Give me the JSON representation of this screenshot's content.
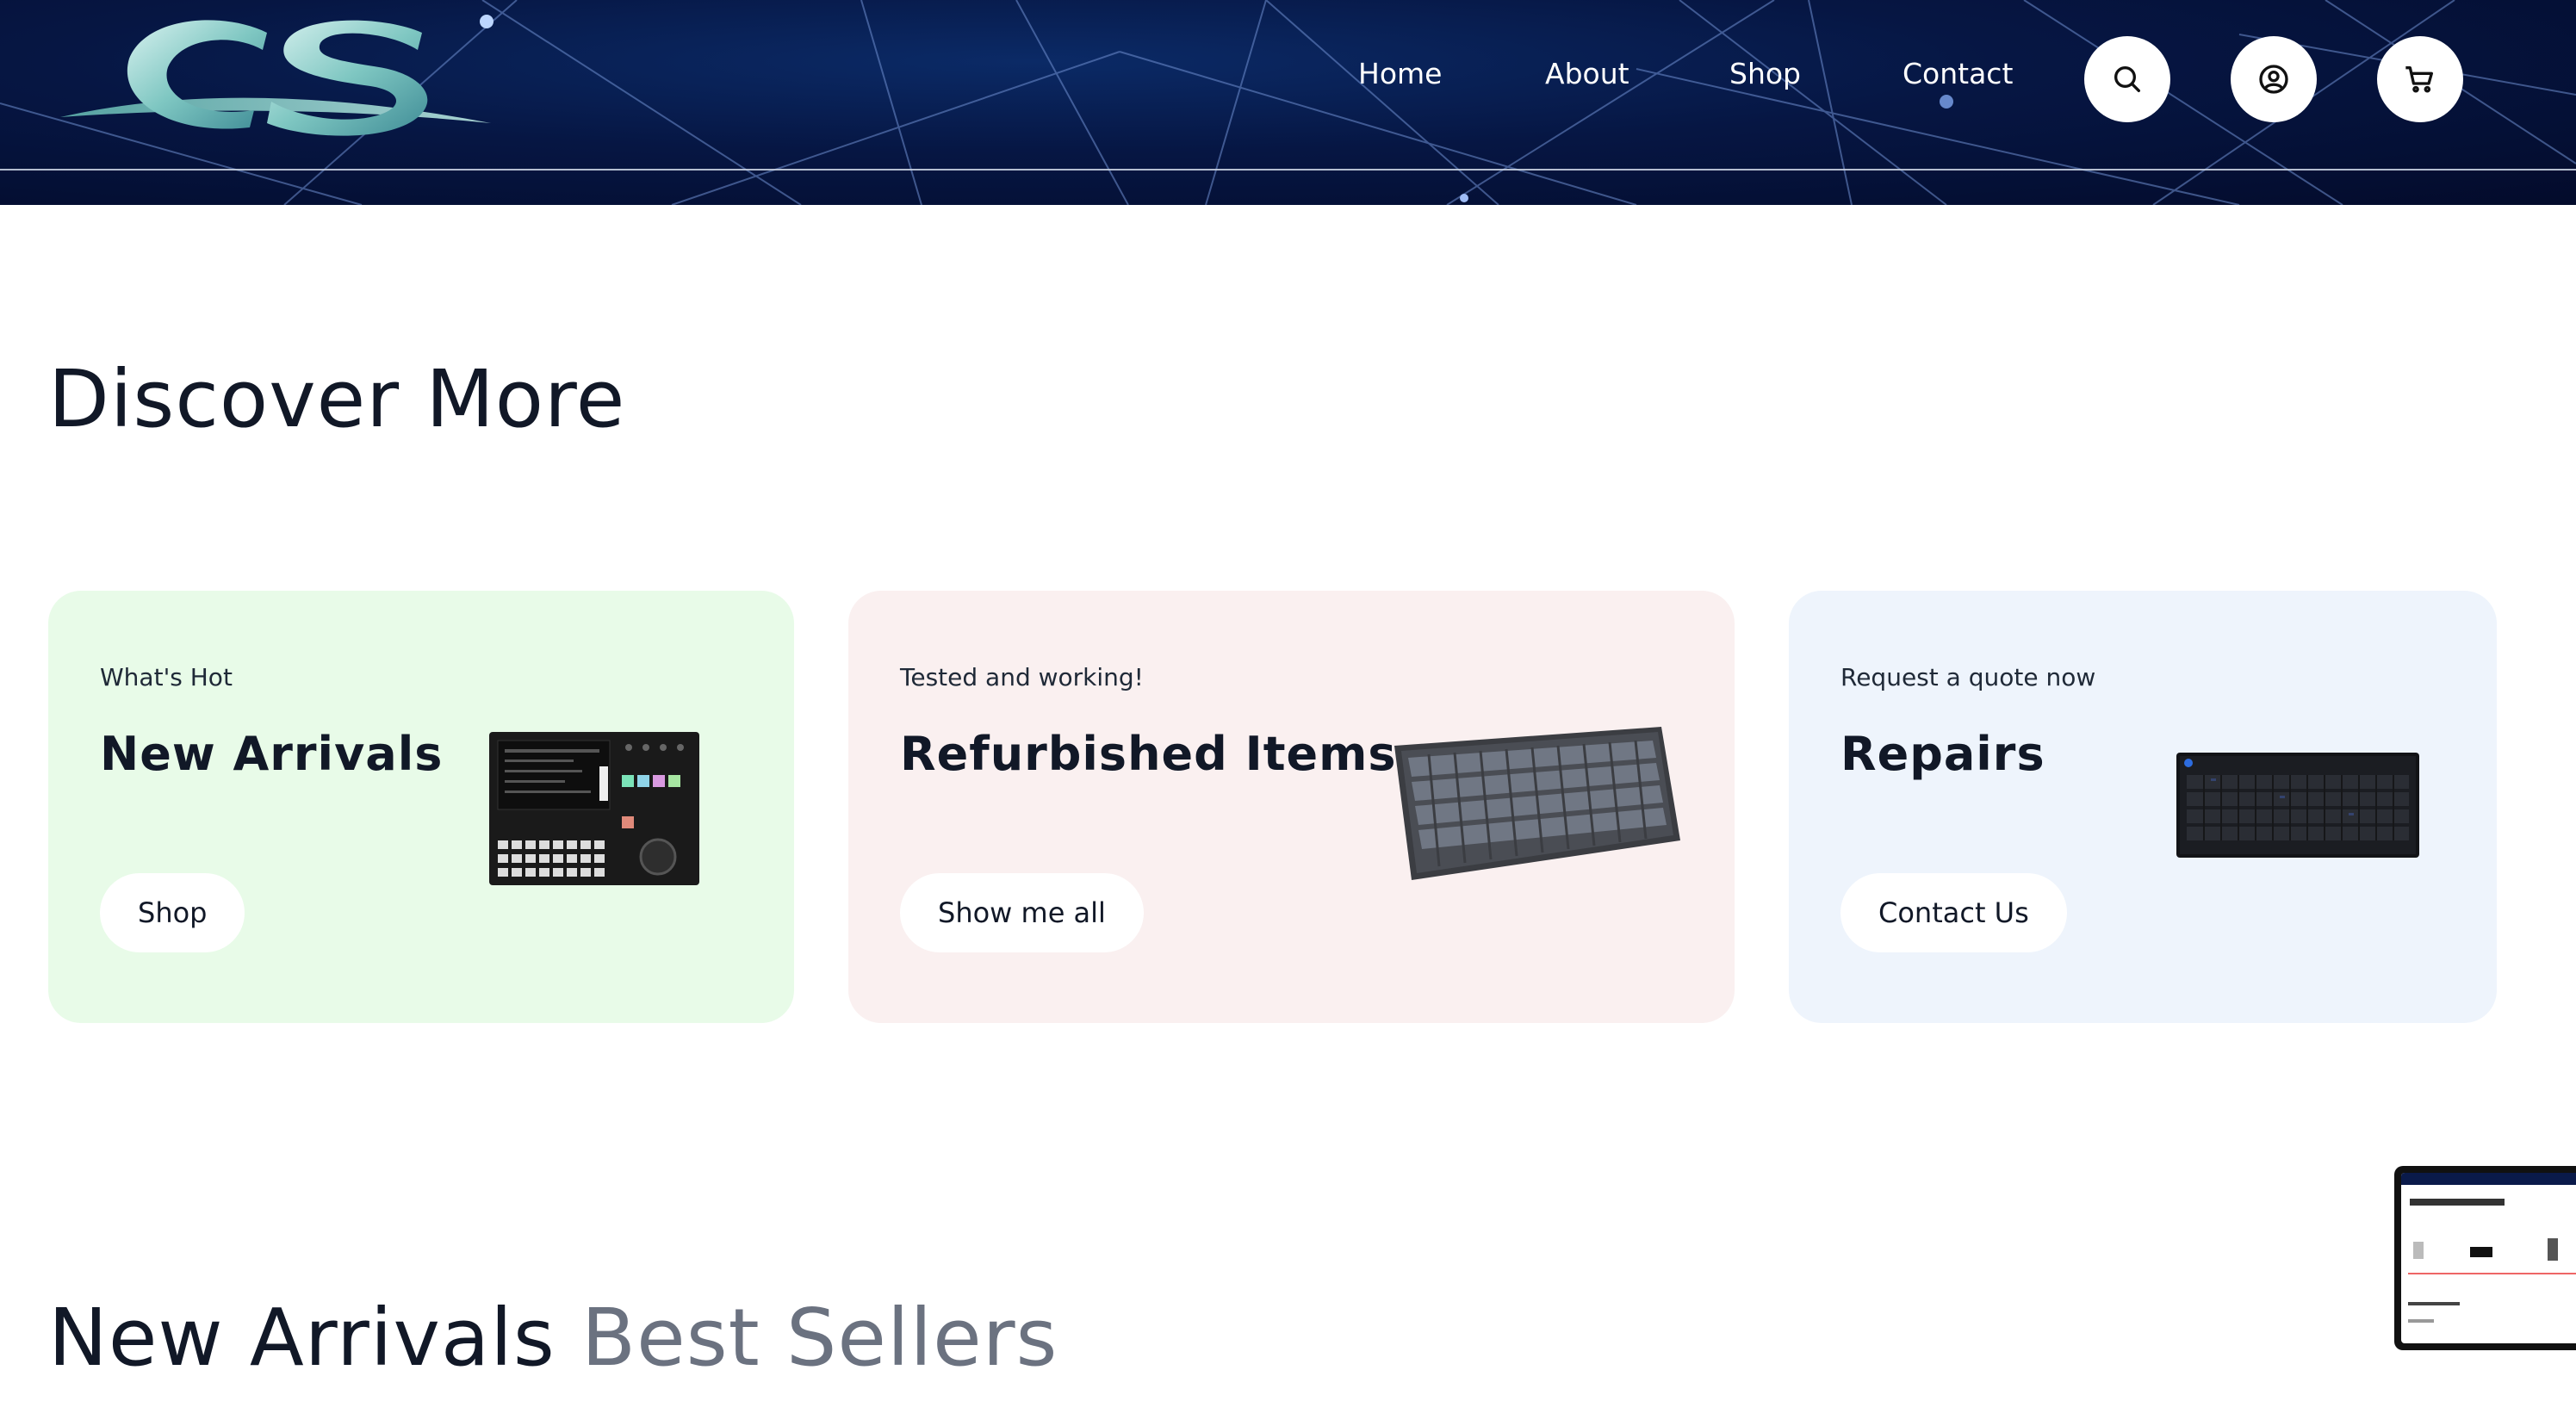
{
  "header": {
    "logo_text": "CS",
    "nav": [
      "Home",
      "About",
      "Shop",
      "Contact"
    ],
    "icons": [
      "search-icon",
      "account-icon",
      "cart-icon"
    ]
  },
  "discover": {
    "title": "Discover More",
    "cards": [
      {
        "eyebrow": "What's Hot",
        "title": "New Arrivals",
        "button": "Shop",
        "bg": "#e8fbe8"
      },
      {
        "eyebrow": "Tested and working!",
        "title": "Refurbished Items",
        "button": "Show me all",
        "bg": "#faf0f0"
      },
      {
        "eyebrow": "Request a quote now",
        "title": "Repairs",
        "button": "Contact Us",
        "bg": "#eef4fc"
      }
    ]
  },
  "arrivals": {
    "tab_active": "New Arrivals",
    "tab_inactive": "Best Sellers"
  },
  "colors": {
    "header_bg": "#061643",
    "text_dark": "#111827",
    "text_muted": "#6b7280"
  }
}
